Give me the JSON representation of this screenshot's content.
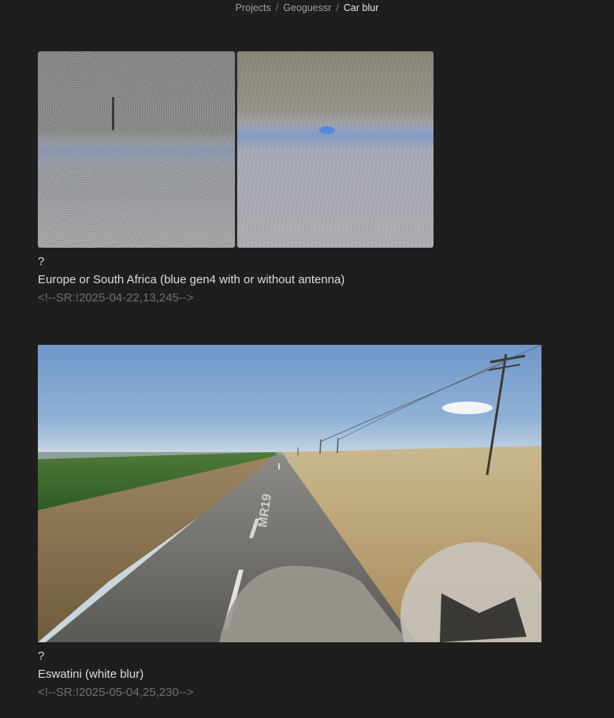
{
  "breadcrumb": {
    "items": [
      "Projects",
      "Geoguessr",
      "Car blur"
    ],
    "separator": "/"
  },
  "cards": [
    {
      "question": "?",
      "answer": "Europe or South Africa (blue gen4 with or without antenna)",
      "sr_comment": "<!--SR:!2025-04-22,13,245-->"
    },
    {
      "question": "?",
      "answer": "Eswatini (white blur)",
      "road_sign": "MR19",
      "sr_comment": "<!--SR:!2025-05-04,25,230-->"
    }
  ],
  "colors": {
    "background": "#1e1e1e",
    "text": "#dcddde",
    "muted": "#6f6f6f",
    "sky": "#6f97c8"
  }
}
